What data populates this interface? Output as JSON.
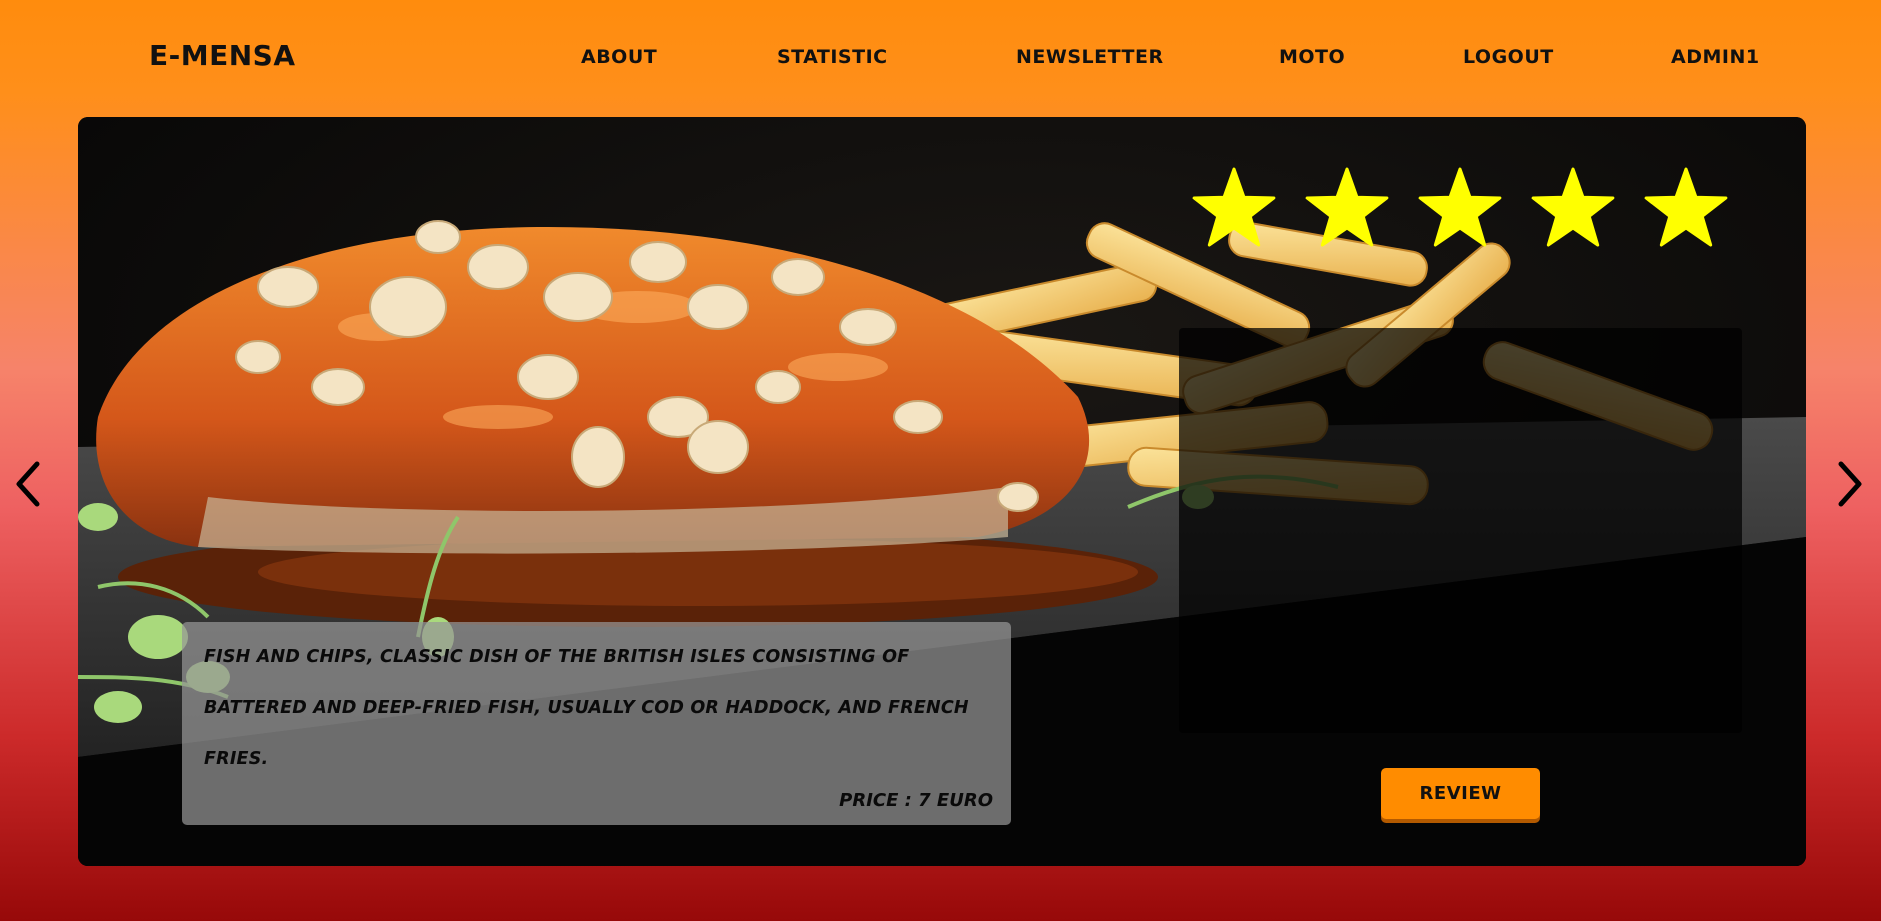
{
  "header": {
    "brand": "E-MENSA",
    "nav": {
      "about": "ABOUT",
      "statistic": "STATISTIC",
      "newsletter": "NEWSLETTER",
      "moto": "MOTO",
      "logout": "LOGOUT",
      "admin": "ADMIN1"
    }
  },
  "slide": {
    "image_icon": "food-photo-fish-and-chips",
    "description": "FISH AND CHIPS, CLASSIC DISH OF THE BRITISH ISLES CONSISTING OF BATTERED AND DEEP-FRIED FISH, USUALLY COD OR HADDOCK, AND FRENCH FRIES.",
    "price": "PRICE : 7 EURO",
    "rating": {
      "value": 5,
      "max": 5,
      "icon": "star-icon",
      "color": "#ffff00"
    },
    "review_button": "REVIEW"
  },
  "controls": {
    "prev_icon": "chevron-left-icon",
    "next_icon": "chevron-right-icon"
  },
  "colors": {
    "accent": "#ff8c00",
    "background_top": "#ff8c0d",
    "background_bottom": "#970909",
    "star": "#ffff00"
  }
}
